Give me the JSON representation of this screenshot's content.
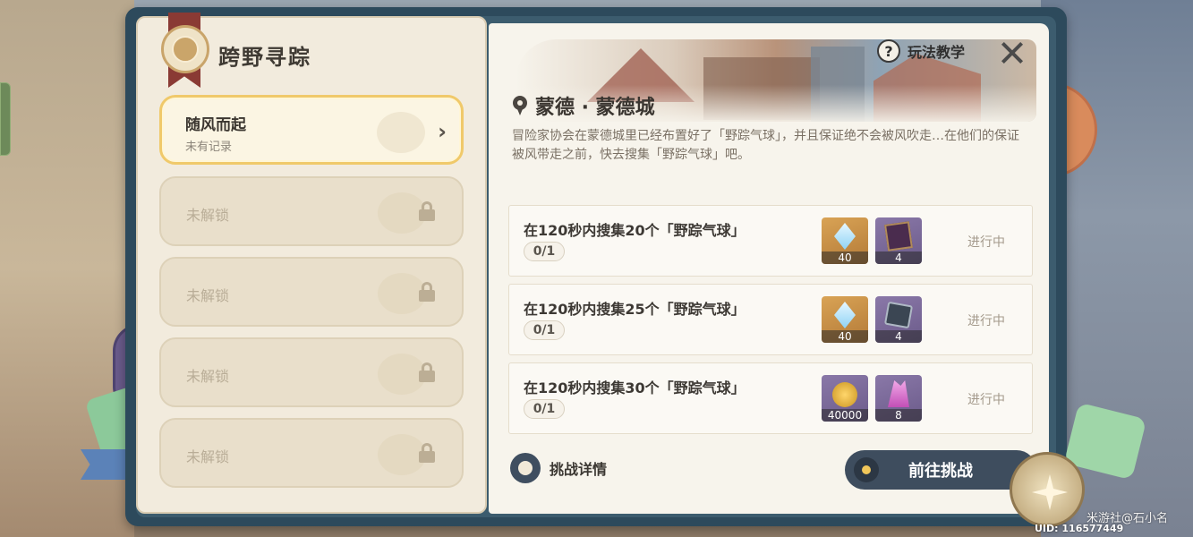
{
  "window": {
    "title": "跨野寻踪"
  },
  "stages": [
    {
      "name": "随风而起",
      "status": "未有记录",
      "state": "active"
    },
    {
      "name": "未解锁",
      "state": "locked"
    },
    {
      "name": "未解锁",
      "state": "locked"
    },
    {
      "name": "未解锁",
      "state": "locked"
    },
    {
      "name": "未解锁",
      "state": "locked"
    }
  ],
  "header": {
    "help_label": "玩法教学",
    "help_icon": "?",
    "close_icon": "close-icon"
  },
  "location": {
    "name": "蒙德 · 蒙德城",
    "description": "冒险家协会在蒙德城里已经布置好了「野踪气球」，并且保证绝不会被风吹走…在他们的保证被风带走之前，快去搜集「野踪气球」吧。"
  },
  "tasks": [
    {
      "title": "在120秒内搜集20个「野踪气球」",
      "progress": "0/1",
      "status": "进行中",
      "rewards": [
        {
          "icon": "primogem-icon",
          "count": "40"
        },
        {
          "icon": "heros-wit-book-icon",
          "count": "4"
        }
      ]
    },
    {
      "title": "在120秒内搜集25个「野踪气球」",
      "progress": "0/1",
      "status": "进行中",
      "rewards": [
        {
          "icon": "primogem-icon",
          "count": "40"
        },
        {
          "icon": "enhancement-ore-icon",
          "count": "4"
        }
      ]
    },
    {
      "title": "在120秒内搜集30个「野踪气球」",
      "progress": "0/1",
      "status": "进行中",
      "rewards": [
        {
          "icon": "mora-icon",
          "count": "40000"
        },
        {
          "icon": "crystal-icon",
          "count": "8"
        }
      ]
    }
  ],
  "footer": {
    "detail_label": "挑战详情",
    "go_label": "前往挑战"
  },
  "watermark": "米游社@石小名",
  "uid": "UID: 116577449",
  "colors": {
    "frame": "#2d4a5c",
    "page": "#f2ebdd",
    "accent_gold": "#f0c96a",
    "button": "#3e4d5e"
  }
}
